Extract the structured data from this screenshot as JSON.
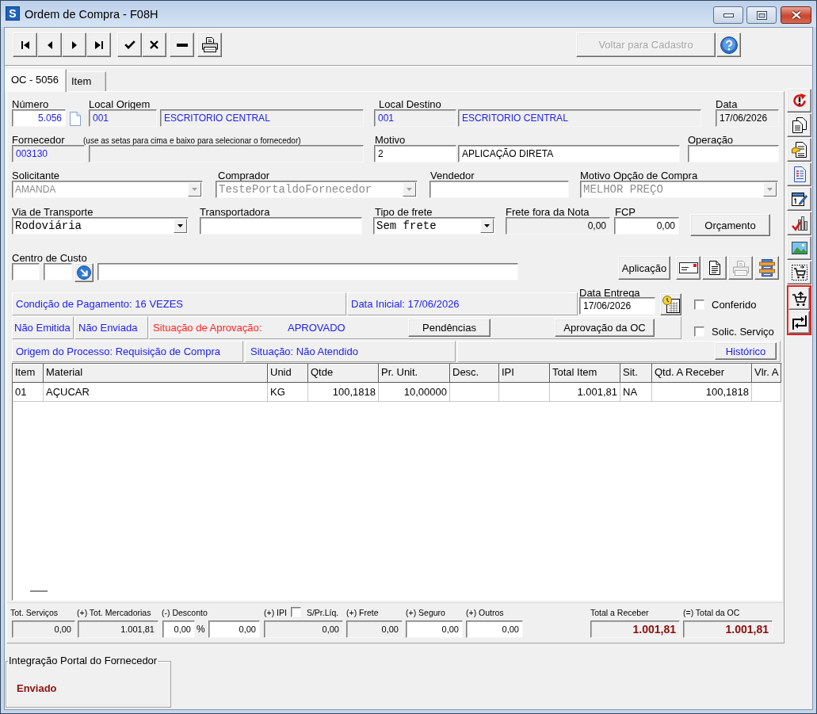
{
  "window": {
    "icon_letter": "S",
    "title": "Ordem de Compra - F08H"
  },
  "toolbar": {
    "back_button": {
      "label": "Voltar para Cadastro",
      "disabled": true
    }
  },
  "tabs": [
    {
      "label": "OC - 5056",
      "selected": true
    },
    {
      "label": "Item",
      "selected": false
    }
  ],
  "header": {
    "numero": {
      "label": "Número",
      "value": "5.056",
      "readonly": false
    },
    "local_origem": {
      "label": "Local Origem",
      "code": "001",
      "name": "ESCRITORIO CENTRAL",
      "readonly": true
    },
    "local_destino": {
      "label": "Local Destino",
      "code": "001",
      "name": "ESCRITORIO CENTRAL",
      "readonly": true
    },
    "data": {
      "label": "Data",
      "value": "17/06/2026",
      "readonly": true
    },
    "fornecedor": {
      "label": "Fornecedor",
      "hint": "(use as setas para cima e baixo para selecionar o fornecedor)",
      "code": "003130",
      "readonly": true
    },
    "motivo": {
      "label": "Motivo",
      "code": "2",
      "name": "APLICAÇÃO DIRETA",
      "readonly": false
    },
    "operacao": {
      "label": "Operação",
      "readonly": false
    },
    "solicitante": {
      "label": "Solicitante",
      "value": "AMANDA",
      "disabled": true
    },
    "comprador": {
      "label": "Comprador",
      "value": "TestePortaldoFornecedor",
      "disabled": true
    },
    "vendedor": {
      "label": "Vendedor",
      "readonly": false
    },
    "motivo_opcao": {
      "label": "Motivo Opção de Compra",
      "value": "MELHOR PREÇO",
      "disabled": true
    },
    "via_transporte": {
      "label": "Via de Transporte",
      "value": "Rodoviária",
      "disabled": false
    },
    "transportadora": {
      "label": "Transportadora",
      "readonly": false
    },
    "tipo_frete": {
      "label": "Tipo de frete",
      "value": "Sem frete",
      "disabled": false
    },
    "frete_fora": {
      "label": "Frete fora da Nota",
      "value": "0,00",
      "readonly": true
    },
    "fcp": {
      "label": "FCP",
      "value": "0,00",
      "readonly": false
    },
    "orcamento_button": {
      "label": "Orçamento"
    },
    "centro_custo": {
      "label": "Centro de Custo",
      "readonly": false
    },
    "aplicacao_button": {
      "label": "Aplicação"
    },
    "print_button": {
      "disabled": true
    }
  },
  "info": {
    "payment_condition": "Condição de Pagamento: 16 VEZES",
    "start_date": "Data Inicial: 17/06/2026",
    "delivery_date": {
      "label": "Data Entrega",
      "value": "17/06/2026",
      "readonly": false
    },
    "emission_status": "Não Emitida",
    "sending_status": "Não Enviada",
    "approval": {
      "label": "Situação de Aprovação:",
      "value": "APROVADO"
    },
    "pending_button": {
      "label": "Pendências"
    },
    "approval_button": {
      "label": "Aprovação da OC"
    },
    "options": [
      {
        "label": "Conferido",
        "checked": false
      },
      {
        "label": "Solic. Serviço",
        "checked": false
      }
    ],
    "origin": "Origem do Processo: Requisição de Compra",
    "situation": "Situação: Não Atendido",
    "history_button": {
      "label": "Histórico"
    }
  },
  "table": {
    "columns": [
      "Item",
      "Material",
      "Unid",
      "Qtde",
      "Pr. Unit.",
      "Desc.",
      "IPI",
      "Total Item",
      "Sit.",
      "Qtd. A Receber",
      "Vlr. A"
    ],
    "rows": [
      {
        "cells": [
          "01",
          "AÇUCAR",
          "KG",
          "100,1818",
          "10,00000",
          null,
          null,
          "1.001,81",
          "NA",
          "100,1818",
          null
        ]
      }
    ]
  },
  "totals": {
    "services": {
      "label": "Tot. Serviços",
      "value": "0,00",
      "readonly": true
    },
    "goods": {
      "label": "(+) Tot. Mercadorias",
      "value": "1.001,81",
      "readonly": true
    },
    "discount": {
      "label": "(-) Desconto",
      "percent": "0,00",
      "unit": "%",
      "value": "0,00",
      "readonly": false
    },
    "ipi": {
      "label": "(+) IPI",
      "value": "0,00",
      "readonly": true,
      "net_price_option": {
        "label": "S/Pr.Líq.",
        "checked": false
      }
    },
    "freight": {
      "label": "(+) Frete",
      "value": "0,00",
      "readonly": true
    },
    "insurance": {
      "label": "(+) Seguro",
      "value": "0,00",
      "readonly": false
    },
    "others": {
      "label": "(+) Outros",
      "value": "0,00",
      "readonly": false
    },
    "to_receive": {
      "label": "Total a Receber",
      "value": "1.001,81",
      "readonly": true
    },
    "order_total": {
      "label": "(=) Total da OC",
      "value": "1.001,81",
      "readonly": true
    }
  },
  "portal": {
    "title": "Integração Portal do Fornecedor",
    "status": "Enviado"
  },
  "side_toolbar": {
    "buttons": [
      {
        "highlighted": false
      },
      {
        "highlighted": false
      },
      {
        "highlighted": false
      },
      {
        "highlighted": false
      },
      {
        "highlighted": false
      },
      {
        "highlighted": false
      },
      {
        "highlighted": false
      },
      {
        "highlighted": false
      },
      {
        "highlighted": true
      },
      {
        "highlighted": true
      }
    ]
  }
}
